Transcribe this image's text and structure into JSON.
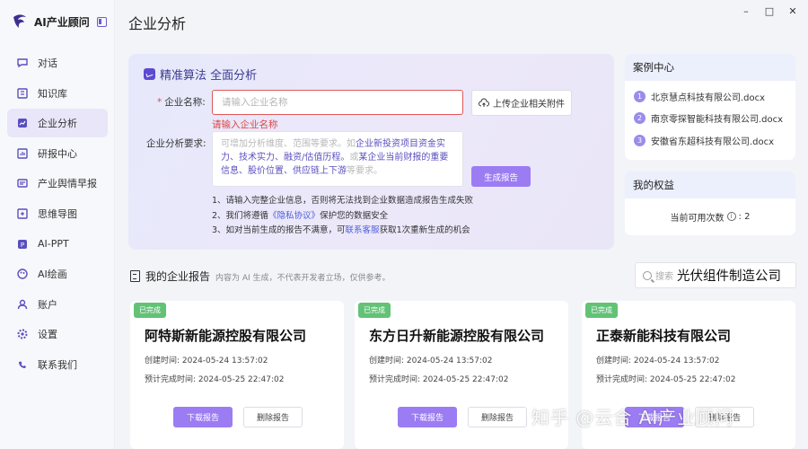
{
  "app": {
    "name": "AI产业顾问"
  },
  "sidebar": {
    "items": [
      {
        "label": "对话",
        "icon": "chat-icon"
      },
      {
        "label": "知识库",
        "icon": "book-icon"
      },
      {
        "label": "企业分析",
        "icon": "analysis-icon",
        "active": true
      },
      {
        "label": "研报中心",
        "icon": "report-icon"
      },
      {
        "label": "产业舆情早报",
        "icon": "news-icon"
      },
      {
        "label": "思维导图",
        "icon": "mindmap-icon"
      },
      {
        "label": "AI-PPT",
        "icon": "ppt-icon"
      },
      {
        "label": "AI绘画",
        "icon": "paint-icon"
      },
      {
        "label": "账户",
        "icon": "user-icon"
      },
      {
        "label": "设置",
        "icon": "gear-icon"
      },
      {
        "label": "联系我们",
        "icon": "phone-icon"
      }
    ]
  },
  "header": {
    "title": "企业分析"
  },
  "window": {
    "minimize": "–",
    "maximize": "□",
    "close": "✕"
  },
  "analysis": {
    "title": "精准算法 全面分析",
    "name_label": "企业名称:",
    "name_placeholder": "请输入企业名称",
    "name_error": "请输入企业名称",
    "upload_label": "上传企业相关附件",
    "req_label": "企业分析要求:",
    "req_placeholder_pre": "可增加分析维度、范围等要求。如",
    "req_placeholder_hl1": "企业新投资项目资金实力、技术实力、融资/估值历程。",
    "req_placeholder_mid": "或",
    "req_placeholder_hl2": "某企业当前财报的重要信息、股价位置、供应链上下游",
    "req_placeholder_post": "等要求。",
    "generate_label": "生成报告",
    "note1": "1、请输入完整企业信息，否则将无法找到企业数据造成报告生成失败",
    "note2_pre": "2、我们将遵循",
    "note2_link": "《隐私协议》",
    "note2_post": "保护您的数据安全",
    "note3_pre": "3、如对当前生成的报告不满意，可",
    "note3_link": "联系客服",
    "note3_post": "获取1次重新生成的机会"
  },
  "cases": {
    "title": "案例中心",
    "items": [
      {
        "num": "1",
        "name": "北京慧点科技有限公司.docx"
      },
      {
        "num": "2",
        "name": "南京零探智能科技有限公司.docx"
      },
      {
        "num": "3",
        "name": "安徽省东超科技有限公司.docx"
      }
    ]
  },
  "rights": {
    "title": "我的权益",
    "label": "当前可用次数",
    "info": "i",
    "value": ": 2"
  },
  "reports": {
    "title": "我的企业报告",
    "subtitle": "内容为 AI 生成，不代表开发者立场，仅供参考。",
    "search_placeholder": "搜索",
    "search_value": "光伏组件制造公司",
    "items": [
      {
        "badge": "已完成",
        "name": "阿特斯新能源控股有限公司",
        "created": "创建时间:  2024-05-24 13:57:02",
        "eta": "预计完成时间:  2024-05-25 22:47:02",
        "download": "下载报告",
        "delete": "删除报告"
      },
      {
        "badge": "已完成",
        "name": "东方日升新能源控股有限公司",
        "created": "创建时间:  2024-05-24 13:57:02",
        "eta": "预计完成时间:  2024-05-25 22:47:02",
        "download": "下载报告",
        "delete": "删除报告"
      },
      {
        "badge": "已完成",
        "name": "正泰新能科技有限公司",
        "created": "创建时间:  2024-05-24 13:57:02",
        "eta": "预计完成时间:  2024-05-25 22:47:02",
        "download": "下载报告",
        "delete": "删除报告"
      }
    ]
  },
  "watermark": "知乎 @云合 AI产业顾问"
}
